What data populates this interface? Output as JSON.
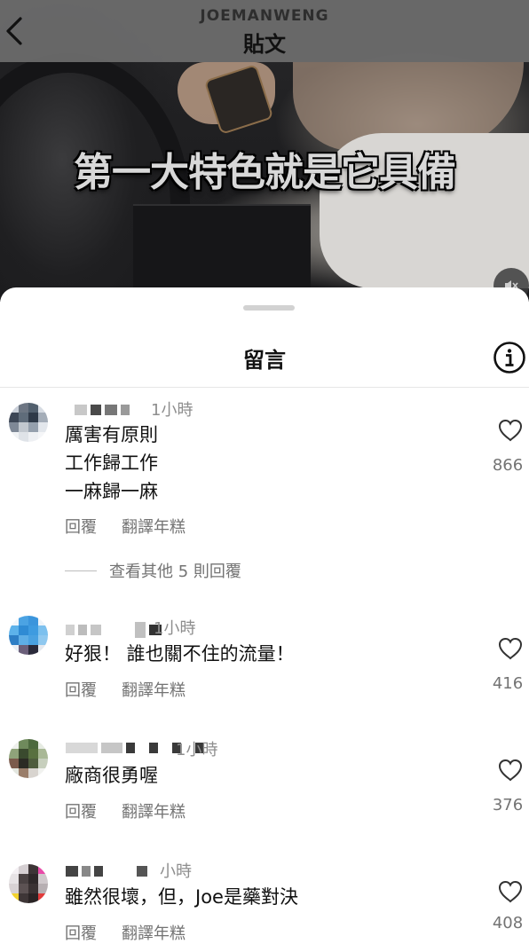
{
  "header": {
    "username": "JOEMANWENG",
    "title": "貼文",
    "back_icon": "chevron-left-icon"
  },
  "video": {
    "caption": "第一大特色就是它具備",
    "mute_icon": "speaker-muted-icon"
  },
  "sheet": {
    "title": "留言",
    "info_icon": "info-icon"
  },
  "comments": [
    {
      "time": "1小時",
      "lines": [
        "厲害有原則",
        "工作歸工作",
        "一麻歸一麻"
      ],
      "reply_label": "回覆",
      "translate_label": "翻譯年糕",
      "likes": "866",
      "view_replies": "查看其他 5 則回覆"
    },
    {
      "time": "1小時",
      "lines": [
        "好狠！ 誰也關不住的流量！"
      ],
      "reply_label": "回覆",
      "translate_label": "翻譯年糕",
      "likes": "416"
    },
    {
      "time": "1小時",
      "lines": [
        "廠商很勇喔"
      ],
      "reply_label": "回覆",
      "translate_label": "翻譯年糕",
      "likes": "376"
    },
    {
      "time": "小時",
      "lines": [
        "雖然很壞，但，Joe是藥對決"
      ],
      "reply_label": "回覆",
      "translate_label": "翻譯年糕",
      "likes": "408"
    }
  ]
}
